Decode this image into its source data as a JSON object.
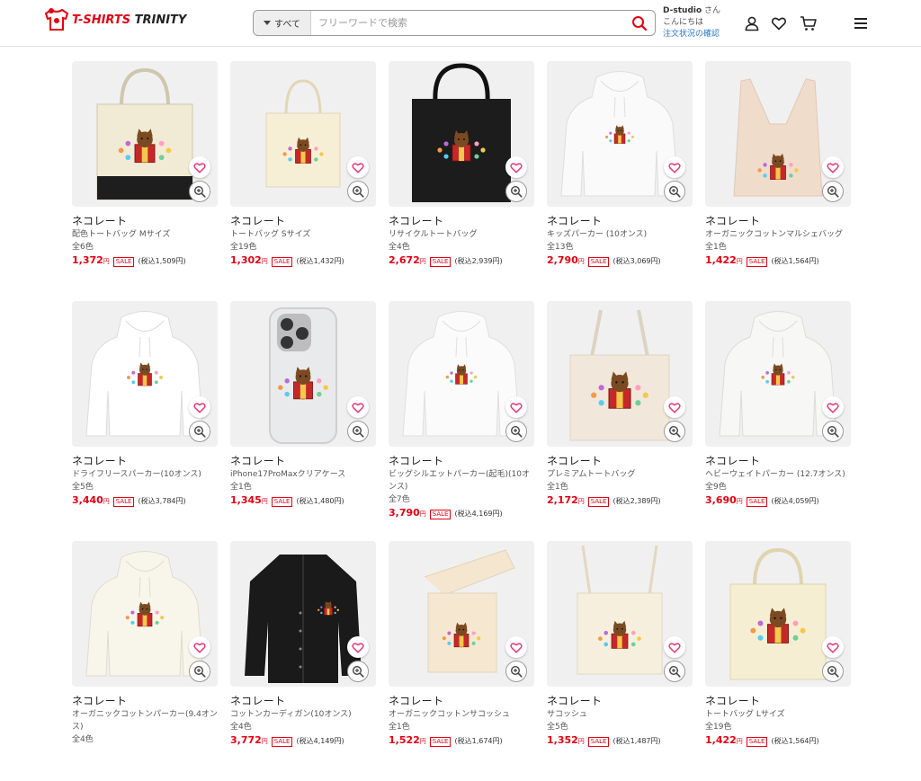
{
  "brand": {
    "name_red": "T-SHIRTS",
    "name_dark": " TRINITY",
    "color": "#e60012"
  },
  "search": {
    "category": "すべて",
    "placeholder": "フリーワードで検索",
    "value": ""
  },
  "user": {
    "name": "D-studio",
    "honorific": " さん",
    "greeting": "こんにちは",
    "orders_link": "注文状況の確認"
  },
  "header_icons": [
    "user-icon",
    "heart-icon",
    "cart-icon",
    "menu-icon"
  ],
  "products": [
    {
      "name": "ネコレート",
      "type": "配色トートバッグ Mサイズ",
      "colors": "全6色",
      "price": "1,372",
      "yen": "円",
      "sale": "SALE",
      "tax": "(税込1,509円)",
      "item": "tote-twotone"
    },
    {
      "name": "ネコレート",
      "type": "トートバッグ Sサイズ",
      "colors": "全19色",
      "price": "1,302",
      "yen": "円",
      "sale": "SALE",
      "tax": "(税込1,432円)",
      "item": "tote-small"
    },
    {
      "name": "ネコレート",
      "type": "リサイクルトートバッグ",
      "colors": "全4色",
      "price": "2,672",
      "yen": "円",
      "sale": "SALE",
      "tax": "(税込2,939円)",
      "item": "tote-black"
    },
    {
      "name": "ネコレート",
      "type": "キッズパーカー (10オンス)",
      "colors": "全13色",
      "price": "2,790",
      "yen": "円",
      "sale": "SALE",
      "tax": "(税込3,069円)",
      "item": "hoodie-kids"
    },
    {
      "name": "ネコレート",
      "type": "オーガニックコットンマルシェバッグ",
      "colors": "全1色",
      "price": "1,422",
      "yen": "円",
      "sale": "SALE",
      "tax": "(税込1,564円)",
      "item": "marche-bag"
    },
    {
      "name": "ネコレート",
      "type": "ドライフリースパーカー(10オンス)",
      "colors": "全5色",
      "price": "3,440",
      "yen": "円",
      "sale": "SALE",
      "tax": "(税込3,784円)",
      "item": "hoodie"
    },
    {
      "name": "ネコレート",
      "type": "iPhone17ProMaxクリアケース",
      "colors": "全1色",
      "price": "1,345",
      "yen": "円",
      "sale": "SALE",
      "tax": "(税込1,480円)",
      "item": "phone-case"
    },
    {
      "name": "ネコレート",
      "type": "ビッグシルエットパーカー(起毛)(10オンス)",
      "colors": "全7色",
      "price": "3,790",
      "yen": "円",
      "sale": "SALE",
      "tax": "(税込4,169円)",
      "item": "hoodie-big"
    },
    {
      "name": "ネコレート",
      "type": "プレミアムトートバッグ",
      "colors": "全1色",
      "price": "2,172",
      "yen": "円",
      "sale": "SALE",
      "tax": "(税込2,389円)",
      "item": "tote-premium"
    },
    {
      "name": "ネコレート",
      "type": "ヘビーウェイトパーカー (12.7オンス)",
      "colors": "全9色",
      "price": "3,690",
      "yen": "円",
      "sale": "SALE",
      "tax": "(税込4,059円)",
      "item": "hoodie-heavy"
    },
    {
      "name": "ネコレート",
      "type": "オーガニックコットンパーカー(9.4オンス)",
      "colors": "全4色",
      "price": "",
      "yen": "",
      "sale": "",
      "tax": "",
      "item": "hoodie-cream"
    },
    {
      "name": "ネコレート",
      "type": "コットンカーディガン(10オンス)",
      "colors": "全4色",
      "price": "3,772",
      "yen": "円",
      "sale": "SALE",
      "tax": "(税込4,149円)",
      "item": "cardigan"
    },
    {
      "name": "ネコレート",
      "type": "オーガニックコットンサコッシュ",
      "colors": "全1色",
      "price": "1,522",
      "yen": "円",
      "sale": "SALE",
      "tax": "(税込1,674円)",
      "item": "sacoche-organic"
    },
    {
      "name": "ネコレート",
      "type": "サコッシュ",
      "colors": "全5色",
      "price": "1,352",
      "yen": "円",
      "sale": "SALE",
      "tax": "(税込1,487円)",
      "item": "sacoche"
    },
    {
      "name": "ネコレート",
      "type": "トートバッグ Lサイズ",
      "colors": "全19色",
      "price": "1,422",
      "yen": "円",
      "sale": "SALE",
      "tax": "(税込1,564円)",
      "item": "tote-large"
    }
  ]
}
